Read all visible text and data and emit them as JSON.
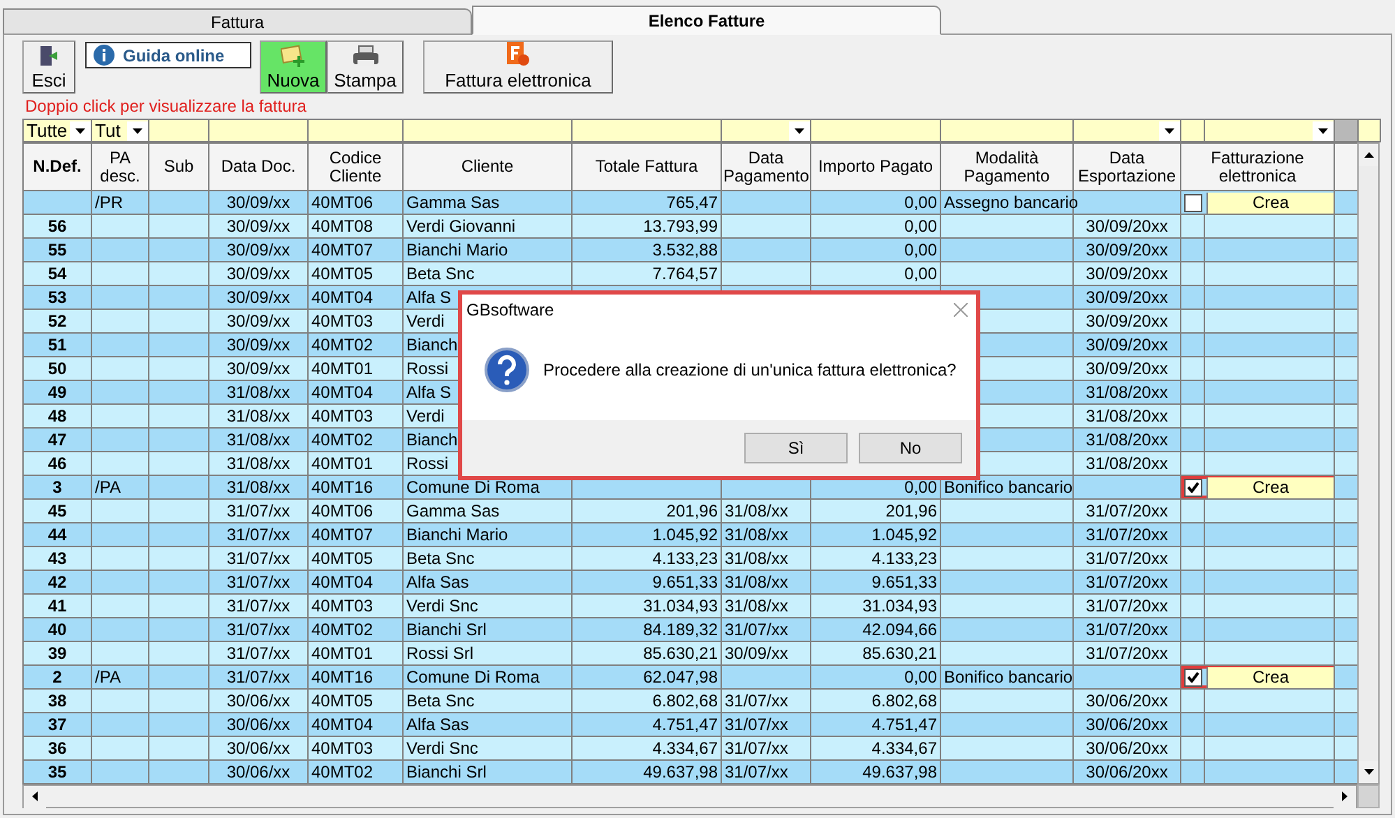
{
  "tabs": [
    {
      "label": "Fattura",
      "selected": false
    },
    {
      "label": "Elenco Fatture",
      "selected": true
    }
  ],
  "toolbar": [
    {
      "kind": "exit",
      "label": "Esci",
      "active": false
    },
    {
      "kind": "help",
      "label": "Guida online",
      "active": false
    },
    {
      "kind": "new",
      "label": "Nuova",
      "active": true
    },
    {
      "kind": "print",
      "label": "Stampa",
      "active": false
    },
    {
      "kind": "einvoice",
      "label": "Fattura elettronica",
      "active": false
    }
  ],
  "hint": "Doppio click per visualizzare la fattura",
  "filters": {
    "ndef": "Tutte",
    "pa": "Tut"
  },
  "columns": [
    "N.Def.",
    "PA desc.",
    "Sub",
    "Data Doc.",
    "Codice Cliente",
    "Cliente",
    "Totale Fattura",
    "Data Pagamento",
    "Importo Pagato",
    "Modalità Pagamento",
    "Data Esportazione",
    "Fatturazione elettronica"
  ],
  "rows": [
    {
      "pa": "/PR",
      "date": "30/09/xx",
      "code": "40MT06",
      "client": "Gamma Sas",
      "total": "765,47",
      "paid": "0,00",
      "method": "Assegno bancario",
      "einvoice": {
        "checked": false,
        "highlighted": false,
        "button": "Crea"
      }
    },
    {
      "num": "56",
      "date": "30/09/xx",
      "code": "40MT08",
      "client": "Verdi Giovanni",
      "total": "13.793,99",
      "paid": "0,00",
      "export": "30/09/20xx"
    },
    {
      "num": "55",
      "date": "30/09/xx",
      "code": "40MT07",
      "client": "Bianchi Mario",
      "total": "3.532,88",
      "paid": "0,00",
      "export": "30/09/20xx"
    },
    {
      "num": "54",
      "date": "30/09/xx",
      "code": "40MT05",
      "client": "Beta Snc",
      "total": "7.764,57",
      "paid": "0,00",
      "export": "30/09/20xx"
    },
    {
      "num": "53",
      "date": "30/09/xx",
      "code": "40MT04",
      "client": "Alfa S",
      "export": "30/09/20xx"
    },
    {
      "num": "52",
      "date": "30/09/xx",
      "code": "40MT03",
      "client": "Verdi",
      "export": "30/09/20xx"
    },
    {
      "num": "51",
      "date": "30/09/xx",
      "code": "40MT02",
      "client": "Bianch",
      "export": "30/09/20xx"
    },
    {
      "num": "50",
      "date": "30/09/xx",
      "code": "40MT01",
      "client": "Rossi",
      "export": "30/09/20xx"
    },
    {
      "num": "49",
      "date": "31/08/xx",
      "code": "40MT04",
      "client": "Alfa S",
      "export": "31/08/20xx"
    },
    {
      "num": "48",
      "date": "31/08/xx",
      "code": "40MT03",
      "client": "Verdi",
      "export": "31/08/20xx"
    },
    {
      "num": "47",
      "date": "31/08/xx",
      "code": "40MT02",
      "client": "Bianch",
      "export": "31/08/20xx"
    },
    {
      "num": "46",
      "date": "31/08/xx",
      "code": "40MT01",
      "client": "Rossi",
      "export": "31/08/20xx"
    },
    {
      "num": "3",
      "pa": "/PA",
      "date": "31/08/xx",
      "code": "40MT16",
      "client": "Comune Di Roma",
      "paid": "0,00",
      "method": "Bonifico bancario",
      "einvoice": {
        "checked": true,
        "highlighted": true,
        "button": "Crea"
      }
    },
    {
      "num": "45",
      "date": "31/07/xx",
      "code": "40MT06",
      "client": "Gamma Sas",
      "total": "201,96",
      "pay_date": "31/08/xx",
      "paid": "201,96",
      "export": "31/07/20xx"
    },
    {
      "num": "44",
      "date": "31/07/xx",
      "code": "40MT07",
      "client": "Bianchi Mario",
      "total": "1.045,92",
      "pay_date": "31/08/xx",
      "paid": "1.045,92",
      "export": "31/07/20xx"
    },
    {
      "num": "43",
      "date": "31/07/xx",
      "code": "40MT05",
      "client": "Beta Snc",
      "total": "4.133,23",
      "pay_date": "31/08/xx",
      "paid": "4.133,23",
      "export": "31/07/20xx"
    },
    {
      "num": "42",
      "date": "31/07/xx",
      "code": "40MT04",
      "client": "Alfa Sas",
      "total": "9.651,33",
      "pay_date": "31/08/xx",
      "paid": "9.651,33",
      "export": "31/07/20xx"
    },
    {
      "num": "41",
      "date": "31/07/xx",
      "code": "40MT03",
      "client": "Verdi Snc",
      "total": "31.034,93",
      "pay_date": "31/08/xx",
      "paid": "31.034,93",
      "export": "31/07/20xx"
    },
    {
      "num": "40",
      "date": "31/07/xx",
      "code": "40MT02",
      "client": "Bianchi Srl",
      "total": "84.189,32",
      "pay_date": "31/07/xx",
      "paid": "42.094,66",
      "export": "31/07/20xx"
    },
    {
      "num": "39",
      "date": "31/07/xx",
      "code": "40MT01",
      "client": "Rossi Srl",
      "total": "85.630,21",
      "pay_date": "30/09/xx",
      "paid": "85.630,21",
      "export": "31/07/20xx"
    },
    {
      "num": "2",
      "pa": "/PA",
      "date": "31/07/xx",
      "code": "40MT16",
      "client": "Comune Di Roma",
      "total": "62.047,98",
      "paid": "0,00",
      "method": "Bonifico bancario",
      "einvoice": {
        "checked": true,
        "highlighted": true,
        "button": "Crea"
      }
    },
    {
      "num": "38",
      "date": "30/06/xx",
      "code": "40MT05",
      "client": "Beta Snc",
      "total": "6.802,68",
      "pay_date": "31/07/xx",
      "paid": "6.802,68",
      "export": "30/06/20xx"
    },
    {
      "num": "37",
      "date": "30/06/xx",
      "code": "40MT04",
      "client": "Alfa Sas",
      "total": "4.751,47",
      "pay_date": "31/07/xx",
      "paid": "4.751,47",
      "export": "30/06/20xx"
    },
    {
      "num": "36",
      "date": "30/06/xx",
      "code": "40MT03",
      "client": "Verdi Snc",
      "total": "4.334,67",
      "pay_date": "31/07/xx",
      "paid": "4.334,67",
      "export": "30/06/20xx"
    },
    {
      "num": "35",
      "date": "30/06/xx",
      "code": "40MT02",
      "client": "Bianchi Srl",
      "total": "49.637,98",
      "pay_date": "31/07/xx",
      "paid": "49.637,98",
      "export": "30/06/20xx"
    }
  ],
  "dialog": {
    "title": "GBsoftware",
    "message": "Procedere alla creazione di un'unica fattura elettronica?",
    "buttons": [
      "Sì",
      "No"
    ],
    "highlighted": true
  }
}
